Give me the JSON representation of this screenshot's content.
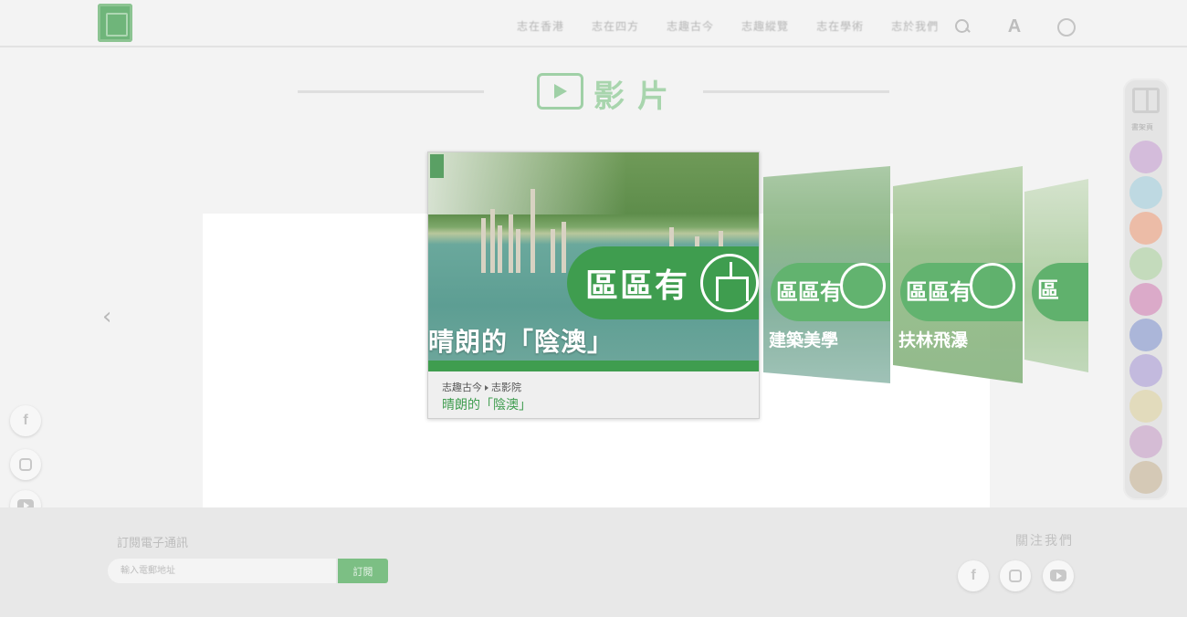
{
  "header": {
    "nav": [
      "志在香港",
      "志在四方",
      "志趣古今",
      "志趣縱覽",
      "志在學術",
      "志於我們"
    ],
    "icons": [
      "search-icon",
      "font-size-icon",
      "globe-icon"
    ],
    "font_size_glyph": "A"
  },
  "section": {
    "title": "影片",
    "icon": "play-icon"
  },
  "carousel": {
    "prev_arrow": "‹",
    "main_card": {
      "badge_text": "區區有",
      "caption": "晴朗的「陰澳」",
      "breadcrumb_parent": "志趣古今",
      "breadcrumb_child": "志影院",
      "title": "晴朗的「陰澳」"
    },
    "side_cards": [
      {
        "badge_text": "區區有",
        "caption": "建築美學"
      },
      {
        "badge_text": "區區有",
        "caption": "扶林飛瀑"
      },
      {
        "badge_text": "區",
        "caption": ""
      }
    ]
  },
  "rail": {
    "label": "書架頁",
    "icon": "book-icon",
    "dot_colors": [
      "#c79ad3",
      "#9fd0e0",
      "#f29b74",
      "#a9d49a",
      "#d37ab2",
      "#7b8fd0",
      "#a898d8",
      "#e0d49a",
      "#c99ac9",
      "#c9b290"
    ]
  },
  "social_left": [
    "facebook-icon",
    "instagram-icon",
    "youtube-icon"
  ],
  "footer": {
    "subscribe_label": "訂閱電子通訊",
    "email_placeholder": "輸入電郵地址",
    "subscribe_button": "訂閱",
    "follow_label": "關注我們",
    "follow_icons": [
      "facebook-icon",
      "instagram-icon",
      "youtube-icon"
    ]
  },
  "colors": {
    "brand_green": "#3f9d4f",
    "light_green": "#a8d5ad"
  }
}
